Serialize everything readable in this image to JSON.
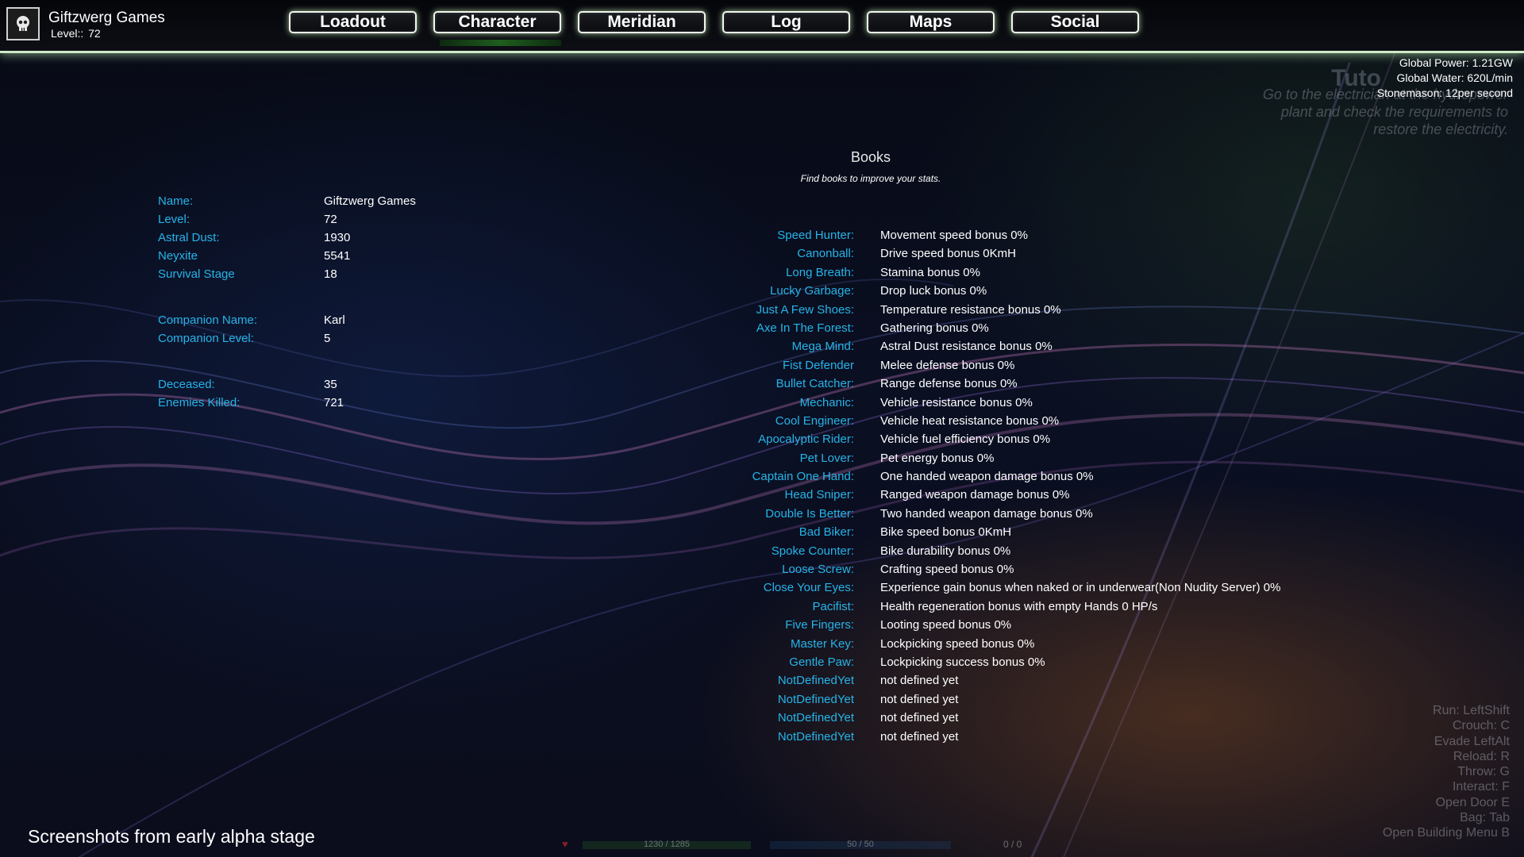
{
  "header": {
    "player_name": "Giftzwerg Games",
    "level_label": "Level::",
    "level_value": "72"
  },
  "nav": {
    "items": [
      "Loadout",
      "Character",
      "Meridian",
      "Log",
      "Maps",
      "Social"
    ],
    "active": "Character"
  },
  "world_stats": [
    "Global Power: 1.21GW",
    "Global Water: 620L/min",
    "Stonemason: 12per second"
  ],
  "tutorial": {
    "title": "Tuto",
    "text": "Go to the electrician at the hydropower plant and check the requirements to restore the electricity."
  },
  "character": {
    "basic": [
      {
        "label": "Name:",
        "value": "Giftzwerg Games"
      },
      {
        "label": "Level:",
        "value": "72"
      },
      {
        "label": "Astral Dust:",
        "value": "1930"
      },
      {
        "label": "Neyxite",
        "value": "5541"
      },
      {
        "label": "Survival Stage",
        "value": "18"
      }
    ],
    "companion": [
      {
        "label": "Companion Name:",
        "value": "Karl"
      },
      {
        "label": "Companion Level:",
        "value": "5"
      }
    ],
    "combat": [
      {
        "label": "Deceased:",
        "value": "35"
      },
      {
        "label": "Enemies Killed:",
        "value": "721"
      }
    ]
  },
  "books": {
    "title": "Books",
    "subtitle": "Find books to improve your stats.",
    "items": [
      {
        "name": "Speed Hunter:",
        "desc": "Movement speed bonus 0%"
      },
      {
        "name": "Canonball:",
        "desc": "Drive speed bonus 0KmH"
      },
      {
        "name": "Long Breath:",
        "desc": "Stamina bonus 0%"
      },
      {
        "name": "Lucky Garbage:",
        "desc": "Drop luck bonus 0%"
      },
      {
        "name": "Just A Few Shoes:",
        "desc": "Temperature resistance bonus 0%"
      },
      {
        "name": "Axe In The Forest:",
        "desc": "Gathering bonus 0%"
      },
      {
        "name": "Mega Mind:",
        "desc": "Astral Dust resistance bonus 0%"
      },
      {
        "name": "Fist Defender",
        "desc": "Melee defense bonus 0%"
      },
      {
        "name": "Bullet Catcher:",
        "desc": "Range defense bonus 0%"
      },
      {
        "name": "Mechanic:",
        "desc": "Vehicle resistance bonus 0%"
      },
      {
        "name": "Cool Engineer:",
        "desc": "Vehicle heat resistance bonus 0%"
      },
      {
        "name": "Apocalyptic Rider:",
        "desc": "Vehicle fuel efficiency bonus 0%"
      },
      {
        "name": "Pet Lover:",
        "desc": "Pet energy bonus 0%"
      },
      {
        "name": "Captain One Hand:",
        "desc": "One handed weapon damage bonus 0%"
      },
      {
        "name": "Head Sniper:",
        "desc": "Ranged weapon damage bonus 0%"
      },
      {
        "name": "Double Is Better:",
        "desc": "Two handed weapon damage bonus 0%"
      },
      {
        "name": "Bad Biker:",
        "desc": "Bike speed bonus 0KmH"
      },
      {
        "name": "Spoke Counter:",
        "desc": "Bike durability bonus 0%"
      },
      {
        "name": "Loose Screw:",
        "desc": "Crafting speed bonus 0%"
      },
      {
        "name": "Close Your Eyes:",
        "desc": "Experience gain bonus when naked or in underwear(Non Nudity Server) 0%"
      },
      {
        "name": "Pacifist:",
        "desc": "Health regeneration bonus with empty Hands 0 HP/s"
      },
      {
        "name": "Five Fingers:",
        "desc": "Looting speed bonus 0%"
      },
      {
        "name": "Master Key:",
        "desc": "Lockpicking speed bonus  0%"
      },
      {
        "name": "Gentle Paw:",
        "desc": "Lockpicking success bonus 0%"
      },
      {
        "name": "NotDefinedYet",
        "desc": "not defined yet"
      },
      {
        "name": "NotDefinedYet",
        "desc": "not defined yet"
      },
      {
        "name": "NotDefinedYet",
        "desc": "not defined yet"
      },
      {
        "name": "NotDefinedYet",
        "desc": "not defined yet"
      }
    ]
  },
  "controls": [
    "Run: LeftShift",
    "Crouch: C",
    "Evade LeftAlt",
    "Reload: R",
    "Throw: G",
    "Interact: F",
    "Open Door E",
    "Bag: Tab",
    "Open Building Menu B"
  ],
  "hud": {
    "health": "1230 / 1285",
    "stamina": "50 / 50",
    "ammo": "0 / 0"
  },
  "footer_note": "Screenshots from early alpha stage",
  "colors": {
    "label": "#26b4e8",
    "accent_glow": "#cfe9c6"
  }
}
